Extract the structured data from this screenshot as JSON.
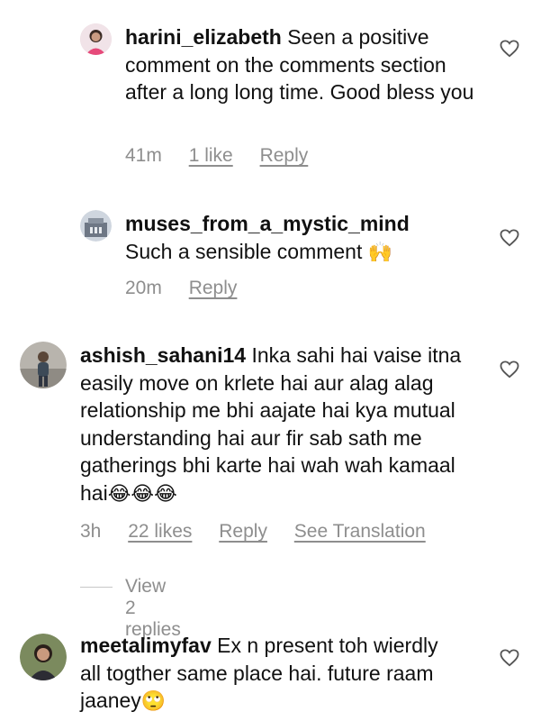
{
  "comments": [
    {
      "username": "harini_elizabeth",
      "text": " Seen a positive comment on the comments section after a long long time. Good bless you",
      "time": "41m",
      "likes": "1 like",
      "reply": "Reply"
    },
    {
      "username": "muses_from_a_mystic_mind",
      "text": "Such a sensible comment ",
      "emoji": "🙌",
      "time": "20m",
      "reply": "Reply"
    },
    {
      "username": "ashish_sahani14",
      "text": " Inka sahi hai vaise itna easily move on krlete hai aur alag alag relationship me bhi aajate hai kya mutual understanding hai aur fir sab sath me gatherings bhi karte hai wah wah kamaal hai",
      "emoji": "😂😂😂",
      "time": "3h",
      "likes": "22 likes",
      "reply": "Reply",
      "translate": "See Translation",
      "view_replies": "View 2 replies"
    },
    {
      "username": "meetalimyfav",
      "text": " Ex n present toh wierdly all togther same place hai. future raam jaaney",
      "emoji": "🙄"
    }
  ]
}
